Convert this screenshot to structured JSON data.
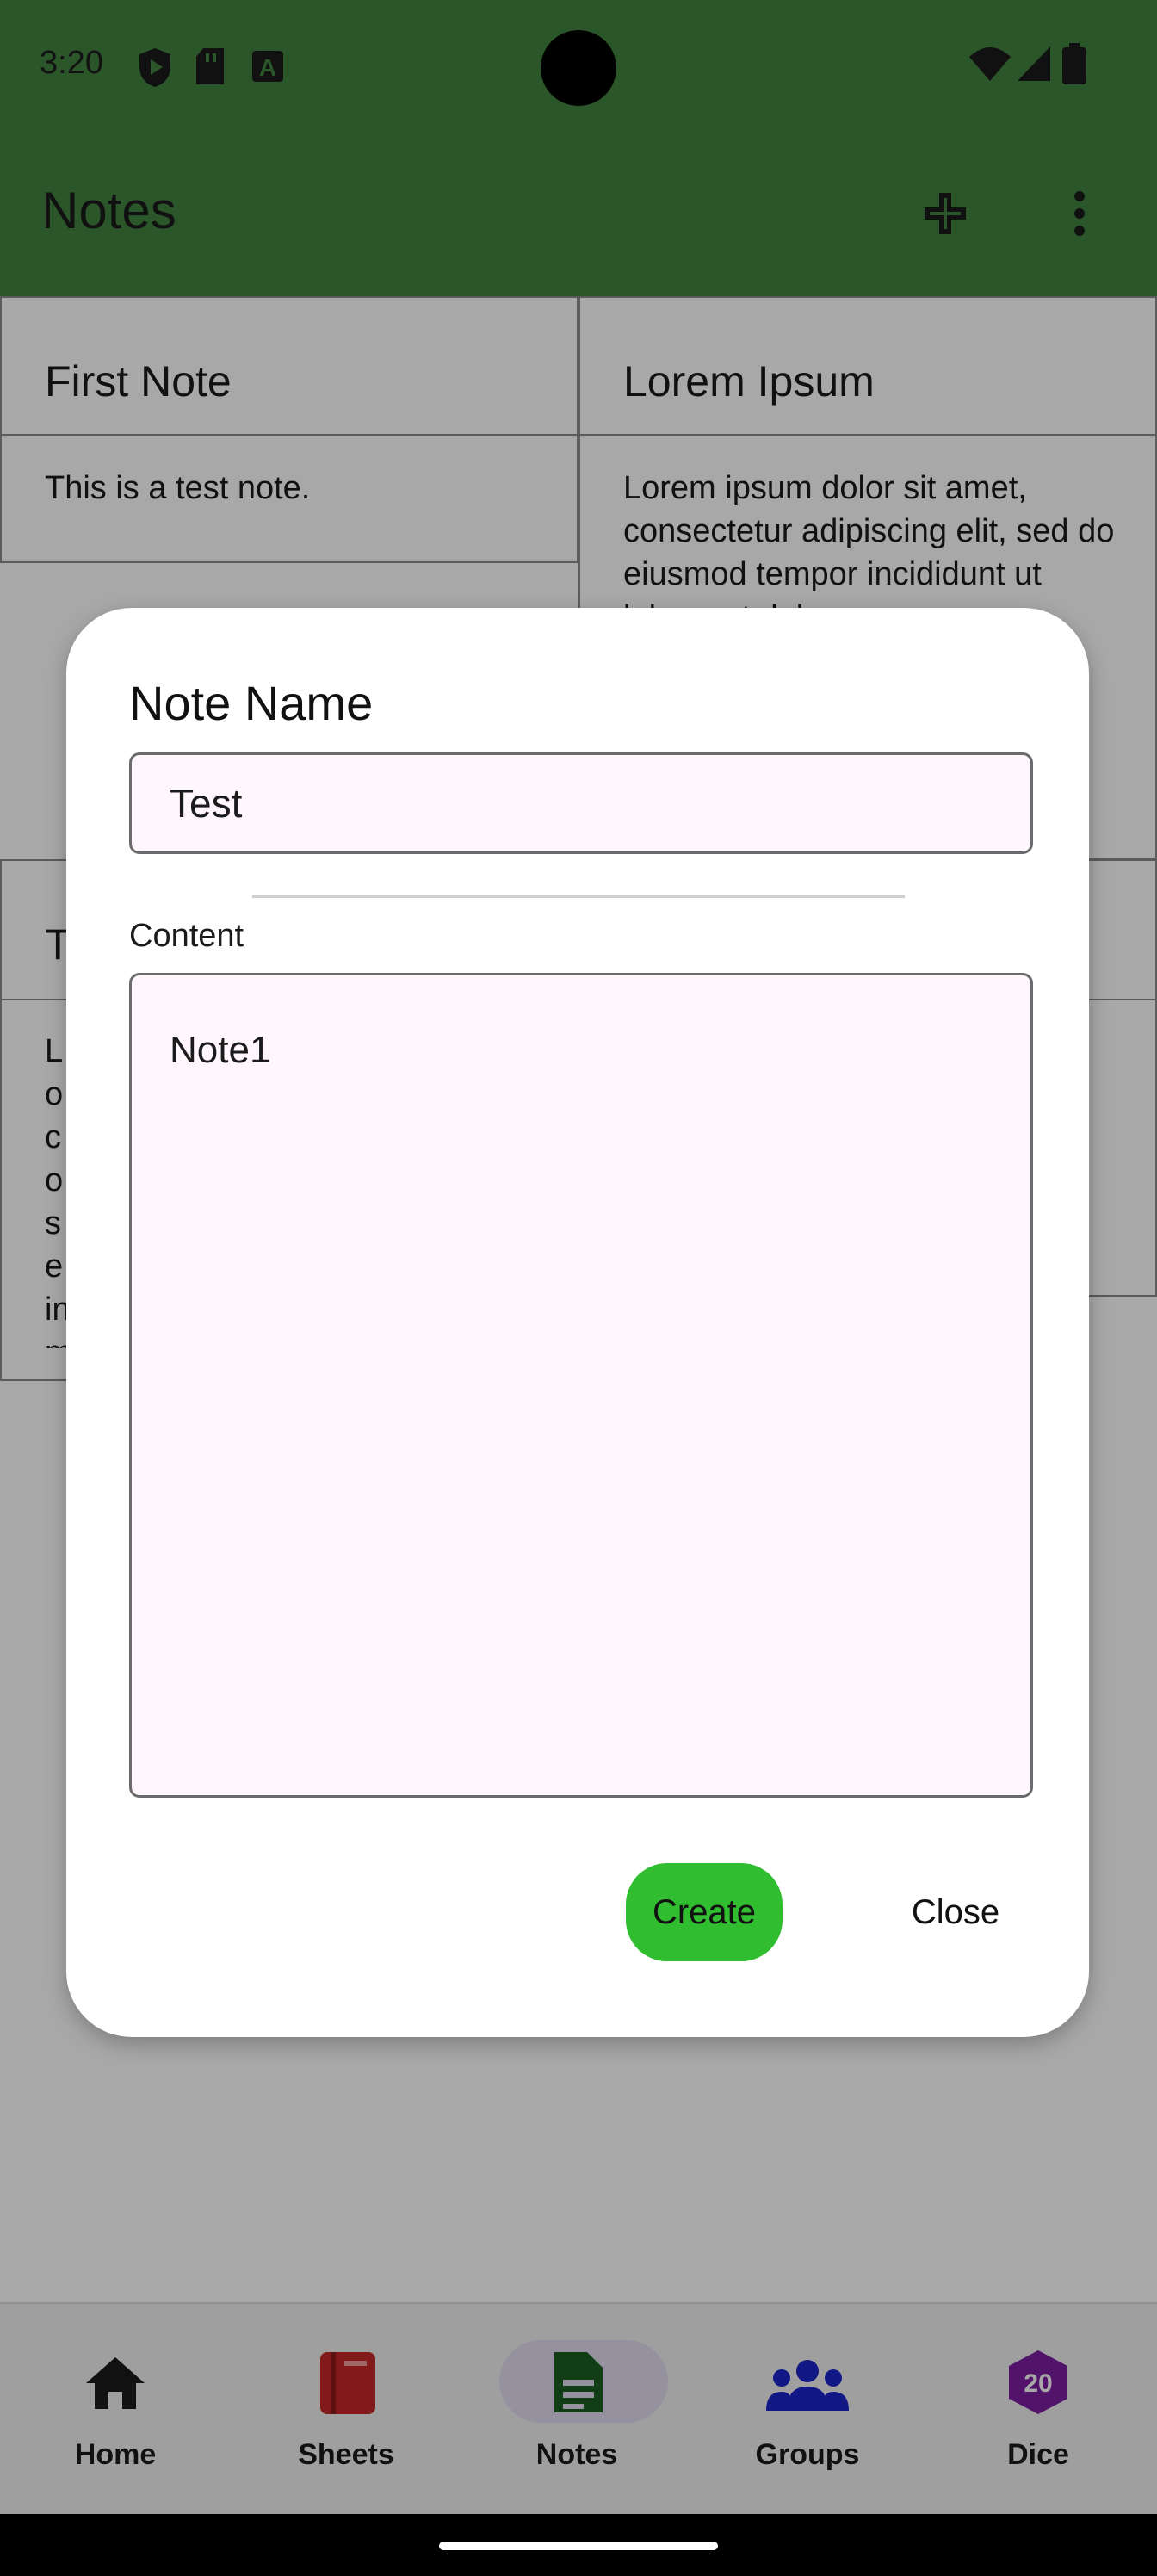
{
  "status_bar": {
    "time": "3:20"
  },
  "app_bar": {
    "title": "Notes"
  },
  "notes": [
    {
      "title": "First Note",
      "body": "This is a test note."
    },
    {
      "title": "Lorem Ipsum",
      "body": "Lorem ipsum dolor sit amet, consectetur adipiscing elit, sed do eiusmod tempor incididunt ut labore et dolore"
    },
    {
      "title": "T",
      "body": "Lo co se in m ni G"
    }
  ],
  "dialog": {
    "title": "Note Name",
    "name_value": "Test",
    "content_label": "Content",
    "content_value": "Note1",
    "create_label": "Create",
    "close_label": "Close"
  },
  "bottom_nav": [
    {
      "label": "Home",
      "icon": "home-icon",
      "color": "#1b1b1b"
    },
    {
      "label": "Sheets",
      "icon": "book-icon",
      "color": "#c62828"
    },
    {
      "label": "Notes",
      "icon": "note-icon",
      "color": "#1b5e20",
      "selected": true
    },
    {
      "label": "Groups",
      "icon": "groups-icon",
      "color": "#1a23c8"
    },
    {
      "label": "Dice",
      "icon": "d20-icon",
      "color": "#7b1fa2",
      "badge": "20"
    }
  ],
  "colors": {
    "accent": "#42833f",
    "create_button": "#30bd30"
  }
}
